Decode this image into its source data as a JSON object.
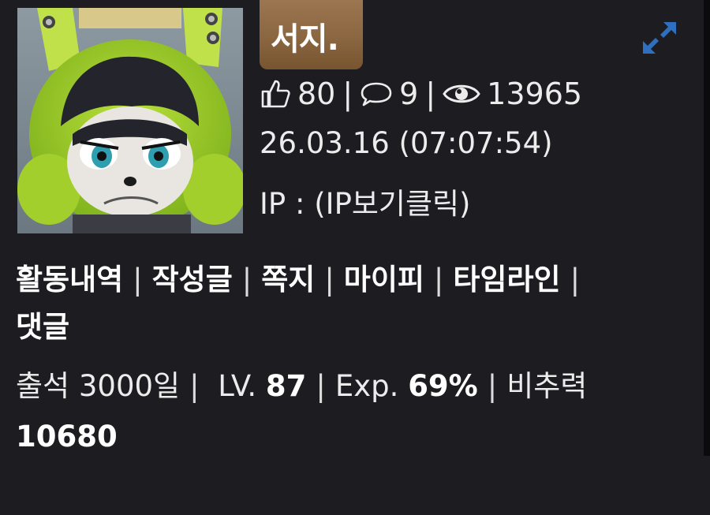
{
  "profile": {
    "nickname": "서지.",
    "likes": "80",
    "comments": "9",
    "views": "13965",
    "date": "26.03.16 (07:07:54)",
    "ip_label": "IP",
    "ip_value": "(IP보기클릭)"
  },
  "links": [
    "활동내역",
    "작성글",
    "쪽지",
    "마이피",
    "타임라인",
    "댓글"
  ],
  "info": {
    "attendance_label": "출석",
    "attendance_value": "3000일",
    "level_label": "LV.",
    "level_value": "87",
    "exp_label": "Exp.",
    "exp_value": "69%",
    "power_label": "비추력",
    "power_value": "10680"
  },
  "colors": {
    "background": "#1d1d21",
    "badge": "#8a6641",
    "expand_icon": "#2f6fc0"
  },
  "icons": [
    "thumbs-up-icon",
    "comment-bubble-icon",
    "eye-icon",
    "expand-icon"
  ]
}
